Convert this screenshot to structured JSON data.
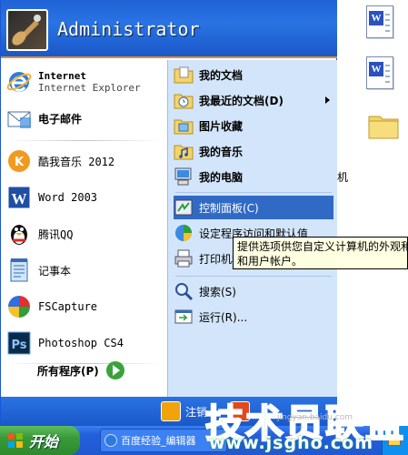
{
  "user": {
    "name": "Administrator"
  },
  "left_pane": {
    "pinned": [
      {
        "title": "Internet",
        "subtitle": "Internet Explorer",
        "icon": "internet-explorer-icon"
      },
      {
        "label": "电子邮件",
        "icon": "email-icon"
      }
    ],
    "recent": [
      {
        "label": "酷我音乐 2012",
        "icon": "kuwo-music-icon"
      },
      {
        "label": "Word 2003",
        "icon": "word-icon"
      },
      {
        "label": "腾讯QQ",
        "icon": "qq-penguin-icon"
      },
      {
        "label": "记事本",
        "icon": "notepad-icon"
      },
      {
        "label": "FSCapture",
        "icon": "fscapture-icon"
      },
      {
        "label": "Photoshop CS4",
        "icon": "photoshop-icon"
      }
    ],
    "all_programs": "所有程序(P)"
  },
  "right_pane": {
    "items": [
      {
        "label": "我的文档",
        "icon": "my-documents-icon"
      },
      {
        "label": "我最近的文档(D)",
        "icon": "recent-documents-icon"
      },
      {
        "label": "图片收藏",
        "icon": "my-pictures-icon"
      },
      {
        "label": "我的音乐",
        "icon": "my-music-icon"
      },
      {
        "label": "我的电脑",
        "icon": "my-computer-icon"
      },
      {
        "label": "控制面板(C)",
        "icon": "control-panel-icon"
      },
      {
        "label": "设定程序访问和默认值",
        "icon": "program-access-icon"
      },
      {
        "label": "打印机和传真",
        "icon": "printer-icon"
      },
      {
        "label": "搜索(S)",
        "icon": "search-icon"
      },
      {
        "label": "运行(R)...",
        "icon": "run-icon"
      }
    ]
  },
  "tooltip": {
    "line1": "提供选项供您自定义计算机的外观和",
    "line2": "和用户帐户。"
  },
  "footer": {
    "logoff": "注销"
  },
  "desktop": {
    "partial_text": "机"
  },
  "taskbar": {
    "start": "开始",
    "task": "百度经验_编辑器"
  },
  "watermark": {
    "big": "技术员联盟",
    "url": "www.jsgho.com",
    "small": "jingyan.baidu.com"
  },
  "colors": {
    "accent": "#316ac5",
    "header": "#1f63d6",
    "start": "#3a9a3a"
  }
}
